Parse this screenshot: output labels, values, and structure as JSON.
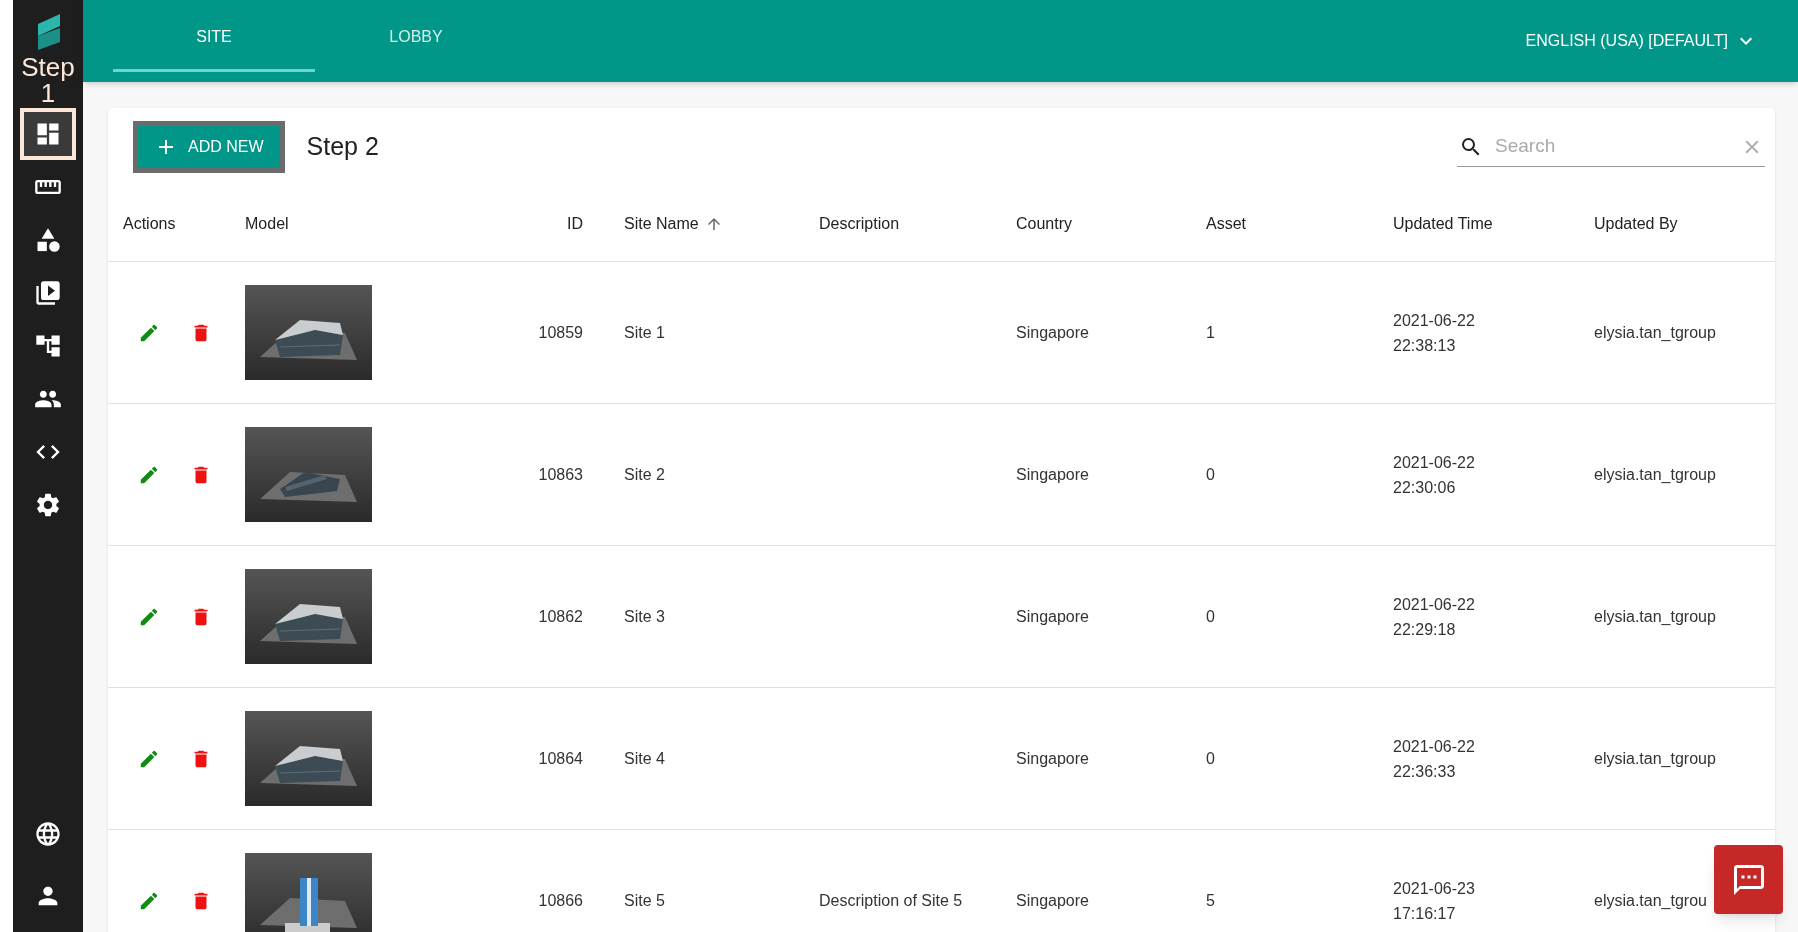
{
  "sidebar": {
    "logo_text": "Step 1",
    "items": [
      {
        "kind": "dashboard",
        "selected": true
      },
      {
        "kind": "ruler",
        "selected": false
      },
      {
        "kind": "shapes",
        "selected": false
      },
      {
        "kind": "video",
        "selected": false
      },
      {
        "kind": "tree",
        "selected": false
      },
      {
        "kind": "people",
        "selected": false
      },
      {
        "kind": "code",
        "selected": false
      },
      {
        "kind": "settings",
        "selected": false
      }
    ],
    "bottom_items": [
      {
        "kind": "globe"
      },
      {
        "kind": "person"
      }
    ]
  },
  "tabs": [
    {
      "label": "SITE",
      "selected": true
    },
    {
      "label": "LOBBY",
      "selected": false
    }
  ],
  "language": "ENGLISH (USA) [DEFAULT]",
  "add_button": "ADD NEW",
  "title": "Step 2",
  "search": {
    "placeholder": "Search"
  },
  "table": {
    "columns": [
      {
        "label": "Actions",
        "sorted": false
      },
      {
        "label": "Model",
        "sorted": false
      },
      {
        "label": "ID",
        "sorted": false
      },
      {
        "label": "Site Name",
        "sorted": true
      },
      {
        "label": "Description",
        "sorted": false
      },
      {
        "label": "Country",
        "sorted": false
      },
      {
        "label": "Asset",
        "sorted": false
      },
      {
        "label": "Updated Time",
        "sorted": false
      },
      {
        "label": "Updated By",
        "sorted": false
      }
    ],
    "rows": [
      {
        "id": "10859",
        "site_name": "Site 1",
        "country": "Singapore",
        "asset": "1",
        "updated_date": "2021-06-22",
        "updated_time": "22:38:13",
        "updated_by": "elysia.tan_tgroup"
      },
      {
        "id": "10863",
        "site_name": "Site 2",
        "country": "Singapore",
        "asset": "0",
        "updated_date": "2021-06-22",
        "updated_time": "22:30:06",
        "updated_by": "elysia.tan_tgroup"
      },
      {
        "id": "10862",
        "site_name": "Site 3",
        "country": "Singapore",
        "asset": "0",
        "updated_date": "2021-06-22",
        "updated_time": "22:29:18",
        "updated_by": "elysia.tan_tgroup"
      },
      {
        "id": "10864",
        "site_name": "Site 4",
        "country": "Singapore",
        "asset": "0",
        "updated_date": "2021-06-22",
        "updated_time": "22:36:33",
        "updated_by": "elysia.tan_tgroup"
      },
      {
        "id": "10866",
        "site_name": "Site 5",
        "description": "Description of Site 5",
        "country": "Singapore",
        "asset": "5",
        "updated_date": "2021-06-23",
        "updated_time": "17:16:17",
        "updated_by": "elysia.tan_tgrou"
      }
    ]
  }
}
